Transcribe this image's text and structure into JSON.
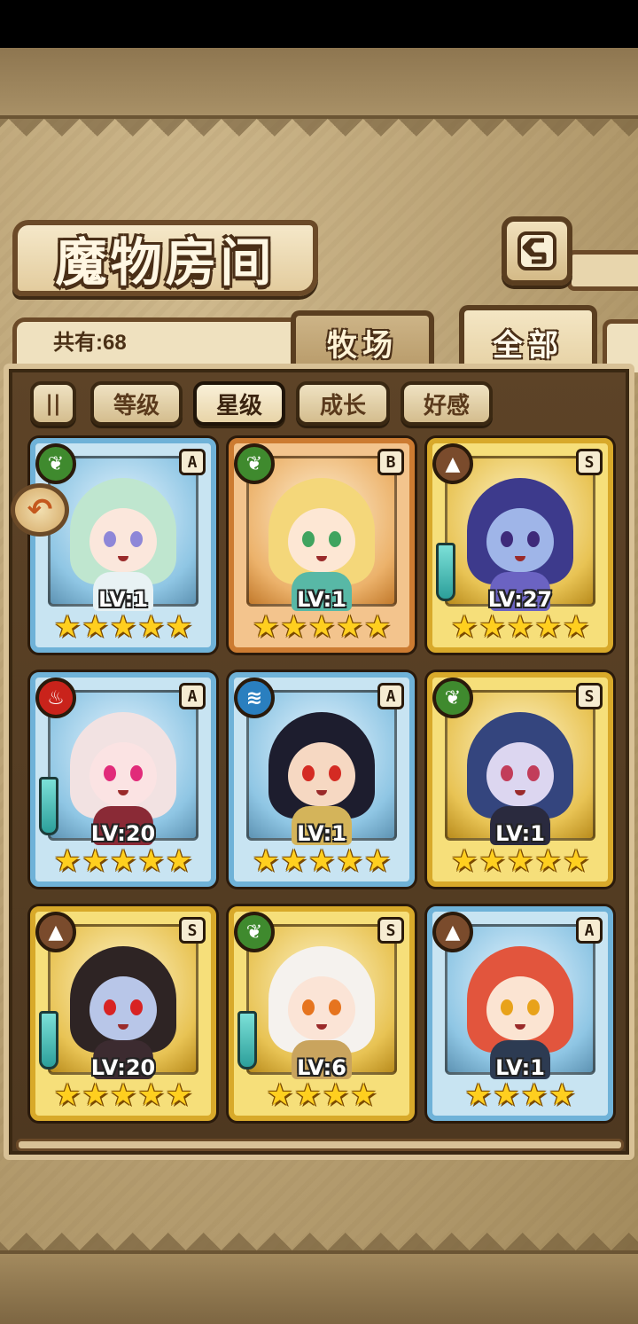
{
  "title": "魔物房间",
  "count_label": "共有:68",
  "tabs": {
    "ranch": "牧场",
    "all": "全部"
  },
  "filters": {
    "toggle": "||",
    "level": "等级",
    "star": "星级",
    "growth": "成长",
    "affinity": "好感"
  },
  "cards": [
    {
      "rank": "A",
      "element": "grass",
      "level": "LV:1",
      "stars": 5,
      "frame": "blue",
      "weapon": false,
      "hair": "#bfe6cf",
      "skin": "#fbe7dc",
      "eye": "#8e87d8",
      "outfit": "#e8f2f4"
    },
    {
      "rank": "B",
      "element": "grass",
      "level": "LV:1",
      "stars": 5,
      "frame": "orange",
      "weapon": false,
      "hair": "#f4d77a",
      "skin": "#fde7d4",
      "eye": "#40a45f",
      "outfit": "#58b8a6"
    },
    {
      "rank": "S",
      "element": "earth",
      "level": "LV:27",
      "stars": 5,
      "frame": "gold",
      "weapon": true,
      "hair": "#3d3a8c",
      "skin": "#9fb5e8",
      "eye": "#3e2a7a",
      "outfit": "#6b63c2"
    },
    {
      "rank": "A",
      "element": "fire",
      "level": "LV:20",
      "stars": 5,
      "frame": "blue",
      "weapon": true,
      "hair": "#f2e2e2",
      "skin": "#fbe3e3",
      "eye": "#e12b7a",
      "outfit": "#8a2a36"
    },
    {
      "rank": "A",
      "element": "water",
      "level": "LV:1",
      "stars": 5,
      "frame": "blue",
      "weapon": false,
      "hair": "#1d1d2e",
      "skin": "#f6d8c2",
      "eye": "#d42b23",
      "outfit": "#d4b45a"
    },
    {
      "rank": "S",
      "element": "grass",
      "level": "LV:1",
      "stars": 5,
      "frame": "gold",
      "weapon": false,
      "hair": "#34457e",
      "skin": "#dcd6f0",
      "eye": "#c23d5a",
      "outfit": "#2a2a3e"
    },
    {
      "rank": "S",
      "element": "earth",
      "level": "LV:20",
      "stars": 5,
      "frame": "gold",
      "weapon": true,
      "hair": "#2e2424",
      "skin": "#b8c6e8",
      "eye": "#d82323",
      "outfit": "#3c2b30"
    },
    {
      "rank": "S",
      "element": "grass",
      "level": "LV:6",
      "stars": 4,
      "frame": "gold",
      "weapon": true,
      "hair": "#f5f2ee",
      "skin": "#fbe4d6",
      "eye": "#e6741e",
      "outfit": "#c9a45e"
    },
    {
      "rank": "A",
      "element": "earth",
      "level": "LV:1",
      "stars": 4,
      "frame": "blue",
      "weapon": false,
      "hair": "#e2553d",
      "skin": "#fbe4d2",
      "eye": "#e8a21a",
      "outfit": "#2d3b52"
    }
  ],
  "element_glyphs": {
    "grass": "❦",
    "fire": "♨",
    "water": "≋",
    "earth": "▲"
  },
  "colors": {
    "panel": "#4e3820",
    "frame_blue": "#6fb2d8",
    "frame_gold": "#d8a92a",
    "frame_orange": "#cc7b31",
    "star": "#ffcf1f"
  }
}
